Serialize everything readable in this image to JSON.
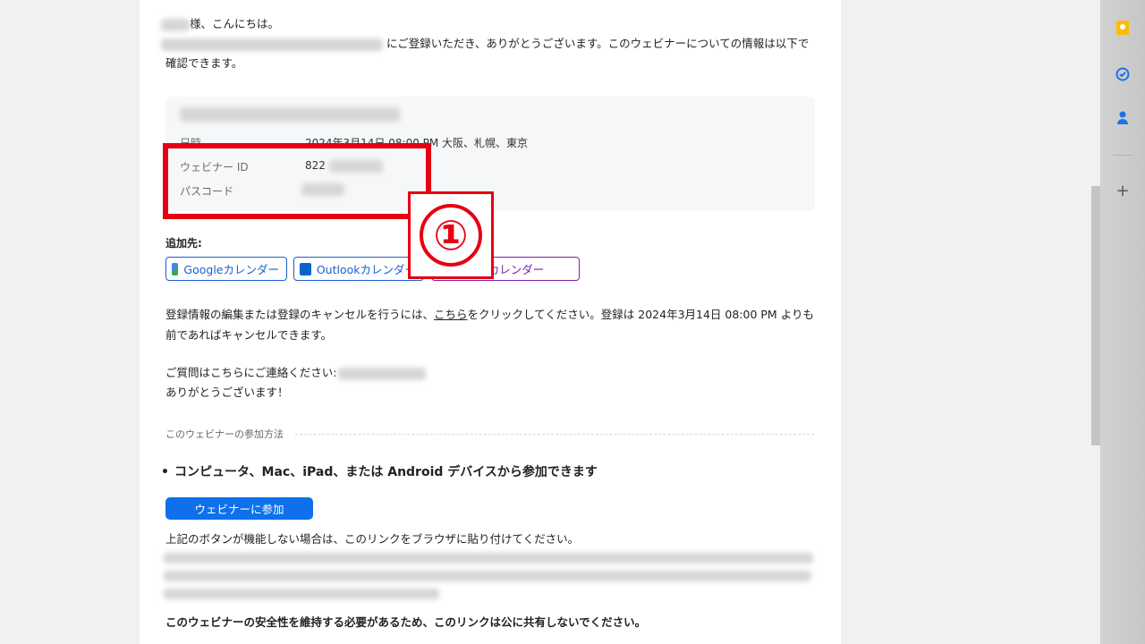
{
  "email": {
    "greeting_suffix": "様、こんにちは。",
    "registration_text": "にご登録いただき、ありがとうございます。このウェビナーについての情報は以下で",
    "registration_text_2": "確認できます。",
    "info": {
      "date_label": "日時",
      "date_value": "2024年3月14日 08:00 PM 大阪、札幌、東京",
      "webinar_id_label": "ウェビナー ID",
      "webinar_id_value": "822",
      "passcode_label": "パスコード"
    },
    "marker_label": "①",
    "add_to_label": "追加先:",
    "calendar_buttons": {
      "google": "Googleカレンダー",
      "outlook": "Outlookカレンダー",
      "yahoo": "Yahooカレンダー"
    },
    "edit_text_1": "登録情報の編集または登録のキャンセルを行うには、",
    "edit_link": "こちら",
    "edit_text_2": "をクリックしてください。登録は 2024年3月14日 08:00 PM よりも",
    "edit_text_3": "前であればキャンセルできます。",
    "contact_text": "ご質問はこちらにご連絡ください:",
    "thanks_text": "ありがとうございます！",
    "join_section_title": "このウェビナーの参加方法",
    "bullet_text": "コンピュータ、Mac、iPad、または Android デバイスから参加できます",
    "join_button": "ウェビナーに参加",
    "link_hint": "上記のボタンが機能しない場合は、このリンクをブラウザに貼り付けてください。",
    "security_note": "このウェビナーの安全性を維持する必要があるため、このリンクは公に共有しないでください。"
  },
  "sidebar": {
    "icons": [
      "keep-icon",
      "tasks-icon",
      "contacts-icon",
      "add-icon"
    ]
  },
  "colors": {
    "highlight": "#e60012",
    "join_button": "#0e71eb",
    "outlook": "#1a5fd0",
    "yahoo": "#7b1fa2"
  }
}
